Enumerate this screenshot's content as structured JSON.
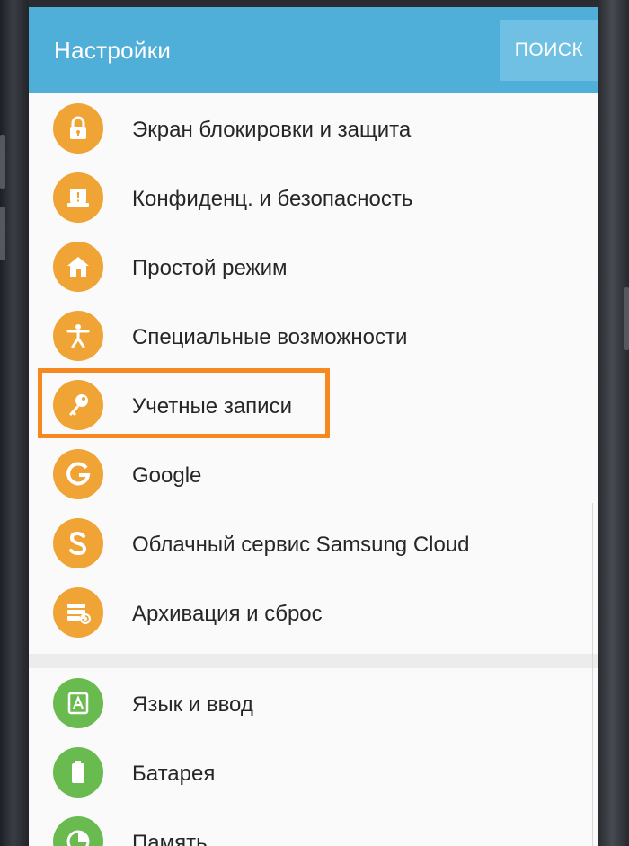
{
  "header": {
    "title": "Настройки",
    "search_label": "ПОИСК"
  },
  "colors": {
    "appbar": "#50afd8",
    "icon_orange": "#f0a436",
    "icon_green": "#6abb4f",
    "highlight": "#f5881f"
  },
  "settings": {
    "items": [
      {
        "label": "Экран блокировки и защита",
        "icon": "lock-icon"
      },
      {
        "label": "Конфиденц. и безопасность",
        "icon": "shield-icon"
      },
      {
        "label": "Простой режим",
        "icon": "easy-home-icon"
      },
      {
        "label": "Специальные возможности",
        "icon": "accessibility-icon"
      },
      {
        "label": "Учетные записи",
        "icon": "key-icon",
        "highlighted": true
      },
      {
        "label": "Google",
        "icon": "google-icon"
      },
      {
        "label": "Облачный сервис Samsung Cloud",
        "icon": "samsung-cloud-icon"
      },
      {
        "label": "Архивация и сброс",
        "icon": "backup-reset-icon"
      }
    ],
    "system_items": [
      {
        "label": "Язык и ввод",
        "icon": "language-icon"
      },
      {
        "label": "Батарея",
        "icon": "battery-icon"
      },
      {
        "label": "Память",
        "icon": "storage-icon"
      }
    ]
  }
}
